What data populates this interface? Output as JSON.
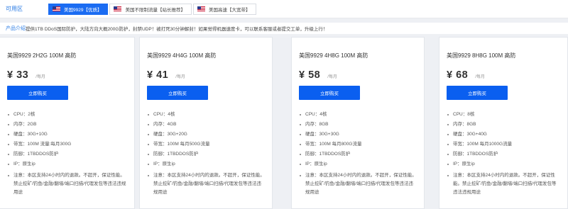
{
  "region": {
    "label": "可用区",
    "tabs": [
      {
        "label": "美国9929【优质】",
        "active": true
      },
      {
        "label": "美国不限制流量【站长推荐】",
        "active": false
      },
      {
        "label": "美国高速【大宽带】",
        "active": false
      }
    ]
  },
  "notice": {
    "label": "产品介绍",
    "text": "提供1TB DDoS国际防护，大陆方向大概200G防护，封禁UDP！被打死30分钟解封！如果觉得机器速度卡，可以联系客服或者提交工单，升级上行！"
  },
  "products": [
    {
      "title": "美国9929 2H2G 100M 高防",
      "price": "¥ 33",
      "unit": "/每月",
      "buy_label": "立即购买",
      "specs": [
        "CPU：2核",
        "内存：2GB",
        "硬盘：30G+10G",
        "带宽：100M 流量:每月300G",
        "防御：1TBDDOS防护",
        "IP：原生ip"
      ],
      "note": "注意：本区支持24小时内的退款。不超开，保证性能。禁止挖矿/钓鱼/金融/翻墙/端口扫描/代理发包等违法违规用途"
    },
    {
      "title": "美国9929 4H4G 100M 高防",
      "price": "¥ 41",
      "unit": "/每月",
      "buy_label": "立即购买",
      "specs": [
        "CPU：4核",
        "内存：4GB",
        "硬盘：30G+20G",
        "带宽：100M 每月500G流量",
        "防御：1TBDDOS防护",
        "IP：原生ip"
      ],
      "note": "注意：本区支持24小时内的退款。不超开，保证性能。禁止挖矿/钓鱼/金融/翻墙/端口扫描/代理发包等违法违规用途"
    },
    {
      "title": "美国9929 4H8G 100M 高防",
      "price": "¥ 58",
      "unit": "/每月",
      "buy_label": "立即购买",
      "specs": [
        "CPU：4核",
        "内存：8GB",
        "硬盘：30G+30G",
        "带宽：100M 每月800G流量",
        "防御：1TBDDOS防护",
        "IP：原生ip"
      ],
      "note": "注意：本区支持24小时内的退款。不超开，保证性能。禁止挖矿/钓鱼/金融/翻墙/端口扫描/代理发包等违法违规用途"
    },
    {
      "title": "美国9929 8H8G 100M 高防",
      "price": "¥ 68",
      "unit": "/每月",
      "buy_label": "立即购买",
      "specs": [
        "CPU：8核",
        "内存：8GB",
        "硬盘：30G+40G",
        "带宽：100M 每月1000G流量",
        "防御：1TBDDOS防护",
        "IP：原生ip"
      ],
      "note": "注意：本区支持24小时内的退款。不超开，保证性能。禁止挖矿/钓鱼/金融/翻墙/端口扫描/代理发包等违法违规用途"
    }
  ],
  "colors": {
    "accent": "#1b6cf2",
    "button": "#0a5ff0",
    "label": "#2a7be4",
    "background": "#eef0f4"
  },
  "icons": {
    "region_tab": "us-flag-icon"
  }
}
